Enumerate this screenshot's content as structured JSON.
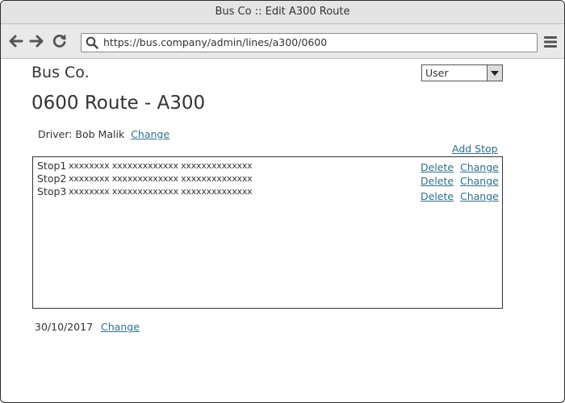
{
  "window": {
    "title": "Bus Co :: Edit A300 Route"
  },
  "browser": {
    "url": "https://bus.company/admin/lines/a300/0600",
    "icons": [
      "back-arrow-icon",
      "forward-arrow-icon",
      "reload-icon",
      "search-icon",
      "hamburger-menu-icon"
    ]
  },
  "header": {
    "brand": "Bus Co.",
    "user_select_value": "User"
  },
  "page": {
    "title": "0600 Route - A300",
    "driver_label": "Driver: Bob Malik",
    "driver_change": "Change",
    "add_stop": "Add Stop",
    "stops": [
      {
        "name": "Stop1",
        "desc": "xxxxxxxx xxxxxxxxxxxxx xxxxxxxxxxxxxx",
        "delete": "Delete",
        "change": "Change"
      },
      {
        "name": "Stop2",
        "desc": "xxxxxxxx xxxxxxxxxxxxx xxxxxxxxxxxxxx",
        "delete": "Delete",
        "change": "Change"
      },
      {
        "name": "Stop3",
        "desc": "xxxxxxxx xxxxxxxxxxxxx xxxxxxxxxxxxxx",
        "delete": "Delete",
        "change": "Change"
      }
    ],
    "date": "30/10/2017",
    "date_change": "Change"
  },
  "colors": {
    "link": "#2f6f8c",
    "chrome": "#e4e4e4",
    "text": "#333333"
  }
}
